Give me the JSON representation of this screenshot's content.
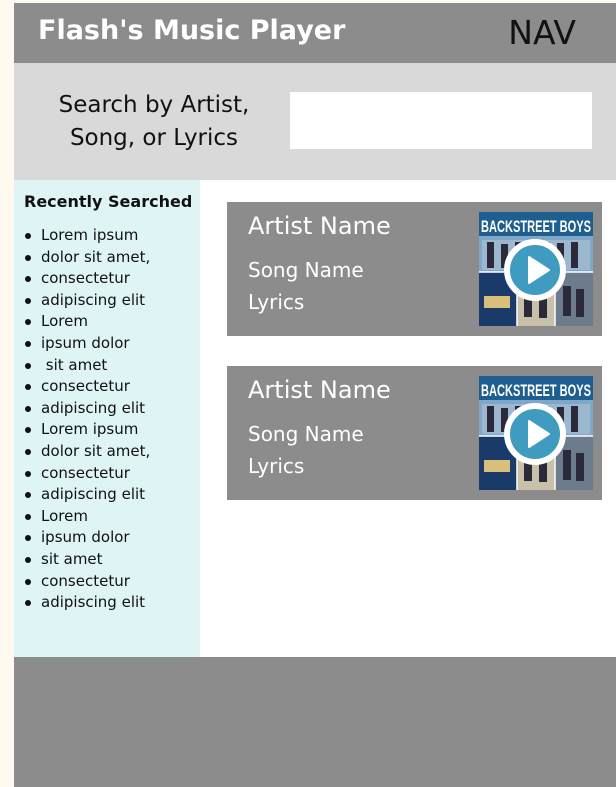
{
  "header": {
    "title": "Flash's Music Player",
    "nav_label": "NAV"
  },
  "search": {
    "label_line1": "Search by Artist,",
    "label_line2": "Song, or Lyrics",
    "value": "",
    "placeholder": ""
  },
  "sidebar": {
    "title": "Recently Searched",
    "items": [
      "Lorem ipsum",
      "dolor sit amet,",
      "consectetur",
      "adipiscing elit",
      "Lorem",
      "ipsum dolor",
      " sit amet",
      "consectetur",
      "adipiscing elit",
      "Lorem ipsum",
      "dolor sit amet,",
      "consectetur",
      "adipiscing elit",
      "Lorem",
      "ipsum dolor",
      "sit amet",
      "consectetur",
      "adipiscing elit"
    ]
  },
  "results": [
    {
      "artist": "Artist Name",
      "song": "Song Name",
      "lyrics": "Lyrics",
      "album_text": "BACKSTREET BOYS"
    },
    {
      "artist": "Artist Name",
      "song": "Song Name",
      "lyrics": "Lyrics",
      "album_text": "BACKSTREET BOYS"
    }
  ],
  "icons": {
    "play": "play-icon",
    "album": "album-cover-image"
  },
  "colors": {
    "header_bg": "#8c8c8c",
    "search_bg": "#d9d9d9",
    "sidebar_bg": "#dff4f5",
    "card_bg": "#8c8c8c",
    "footer_bg": "#8c8c8c"
  }
}
